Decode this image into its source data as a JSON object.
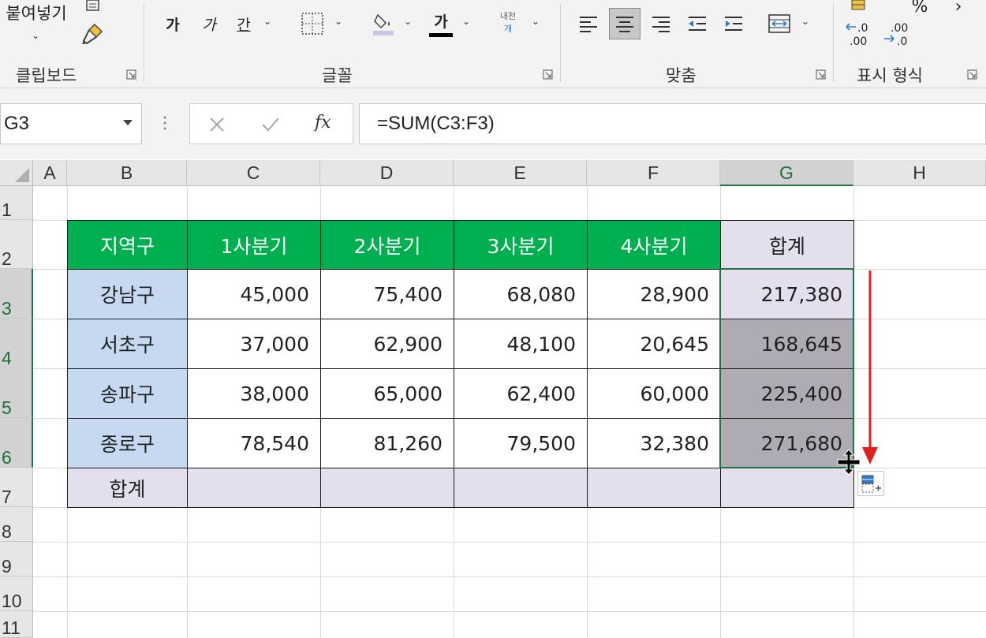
{
  "ribbon": {
    "paste_label": "붙여넣기",
    "bold_label": "가",
    "italic_label": "가",
    "underline_label": "간",
    "font_color_label": "가",
    "phonetic_top": "내천",
    "phonetic_bottom": "개",
    "pct_label": "%",
    "dec_inc_top": ".0",
    "dec_inc_bottom": ".00",
    "dec_dec_top": ".00",
    "dec_dec_bottom": ".0",
    "groups": {
      "clipboard": "클립보드",
      "font": "글꼴",
      "alignment": "맞춤",
      "number": "표시 형식"
    }
  },
  "name_box": {
    "value": "G3"
  },
  "formula_bar": {
    "fx_label": "fx",
    "formula": "=SUM(C3:F3)"
  },
  "grid": {
    "columns": [
      "A",
      "B",
      "C",
      "D",
      "E",
      "F",
      "G",
      "H"
    ],
    "rows": [
      "1",
      "2",
      "3",
      "4",
      "5",
      "6",
      "7",
      "8",
      "9",
      "10",
      "11"
    ],
    "selected_column": "G",
    "selected_rows": [
      "3",
      "4",
      "5",
      "6"
    ]
  },
  "table": {
    "headers": [
      "지역구",
      "1사분기",
      "2사분기",
      "3사분기",
      "4사분기",
      "합계"
    ],
    "rows": [
      {
        "label": "강남구",
        "values": [
          "45,000",
          "75,400",
          "68,080",
          "28,900"
        ],
        "total": "217,380"
      },
      {
        "label": "서초구",
        "values": [
          "37,000",
          "62,900",
          "48,100",
          "20,645"
        ],
        "total": "168,645"
      },
      {
        "label": "송파구",
        "values": [
          "38,000",
          "65,000",
          "62,400",
          "60,000"
        ],
        "total": "225,400"
      },
      {
        "label": "종로구",
        "values": [
          "78,540",
          "81,260",
          "79,500",
          "32,380"
        ],
        "total": "271,680"
      }
    ],
    "total_row_label": "합계"
  },
  "colors": {
    "header_green": "#00b050",
    "label_blue": "#c6d9f0",
    "total_purple": "#e4dfec",
    "selected_dark": "#afabb4",
    "selection_border": "#217346",
    "arrow_red": "#e02020"
  }
}
